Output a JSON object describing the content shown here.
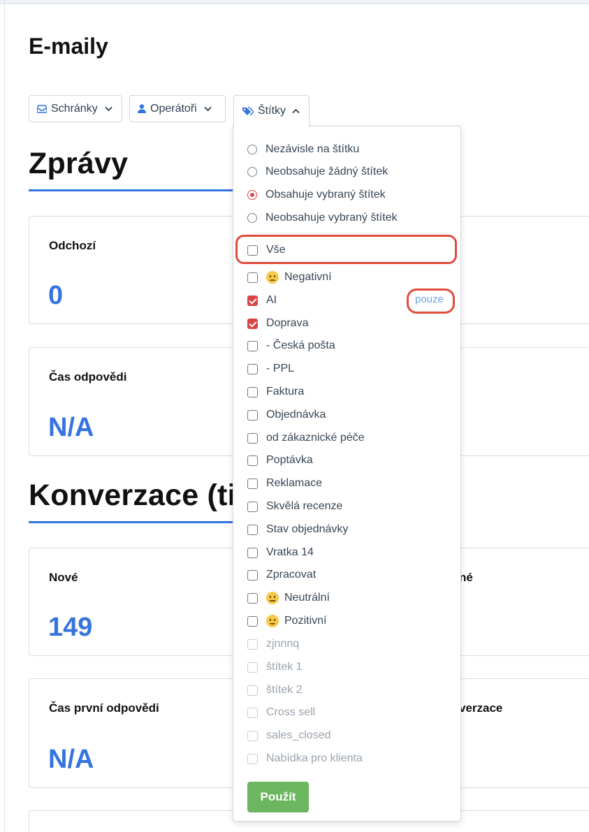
{
  "page": {
    "title": "E-maily"
  },
  "filters": {
    "mailboxes": "Schránky",
    "operators": "Operátoři",
    "tags": "Štítky"
  },
  "sections": {
    "messages": "Zprávy",
    "conversations": "Konverzace (tic"
  },
  "cards": {
    "outgoing_label": "Odchozí",
    "outgoing_value": "0",
    "response_time_label": "Čas odpovědi",
    "response_time_value": "N/A",
    "new_label": "Nové",
    "new_value": "149",
    "new_right_label_fragment": "né",
    "first_response_label": "Čas první odpovědi",
    "first_response_value": "N/A",
    "first_response_right_label_fragment": "verzace"
  },
  "dropdown": {
    "radios": [
      {
        "label": "Nezávisle na štítku",
        "selected": false
      },
      {
        "label": "Neobsahuje žádný štítek",
        "selected": false
      },
      {
        "label": "Obsahuje vybraný štítek",
        "selected": true
      },
      {
        "label": "Neobsahuje vybraný štítek",
        "selected": false
      }
    ],
    "all_label": "Vše",
    "only_link": "pouze",
    "tags": [
      {
        "label": "Negativní",
        "checked": false,
        "emoji": "negative-face-icon"
      },
      {
        "label": "AI",
        "checked": true
      },
      {
        "label": "Doprava",
        "checked": true
      },
      {
        "label": "- Česká pošta",
        "checked": false
      },
      {
        "label": "- PPL",
        "checked": false
      },
      {
        "label": "Faktura",
        "checked": false
      },
      {
        "label": "Objednávka",
        "checked": false
      },
      {
        "label": "od zákaznické péče",
        "checked": false
      },
      {
        "label": "Poptávka",
        "checked": false
      },
      {
        "label": "Reklamace",
        "checked": false
      },
      {
        "label": "Skvělá recenze",
        "checked": false
      },
      {
        "label": "Stav objednávky",
        "checked": false
      },
      {
        "label": "Vratka 14",
        "checked": false
      },
      {
        "label": "Zpracovat",
        "checked": false
      },
      {
        "label": "Neutrální",
        "checked": false,
        "emoji": "neutral-face-icon"
      },
      {
        "label": "Pozitivní",
        "checked": false,
        "emoji": "positive-face-icon"
      },
      {
        "label": "zjnnnq",
        "checked": false,
        "disabled": true
      },
      {
        "label": "štítek 1",
        "checked": false,
        "disabled": true
      },
      {
        "label": "štítek 2",
        "checked": false,
        "disabled": true
      },
      {
        "label": "Cross sell",
        "checked": false,
        "disabled": true
      },
      {
        "label": "sales_closed",
        "checked": false,
        "disabled": true
      },
      {
        "label": "Nabídka pro klienta",
        "checked": false,
        "disabled": true
      }
    ],
    "apply_label": "Použít"
  },
  "colors": {
    "accent": "#3574e0",
    "check": "#d94545",
    "apply": "#6bb65e",
    "highlight": "#e24b3b"
  }
}
